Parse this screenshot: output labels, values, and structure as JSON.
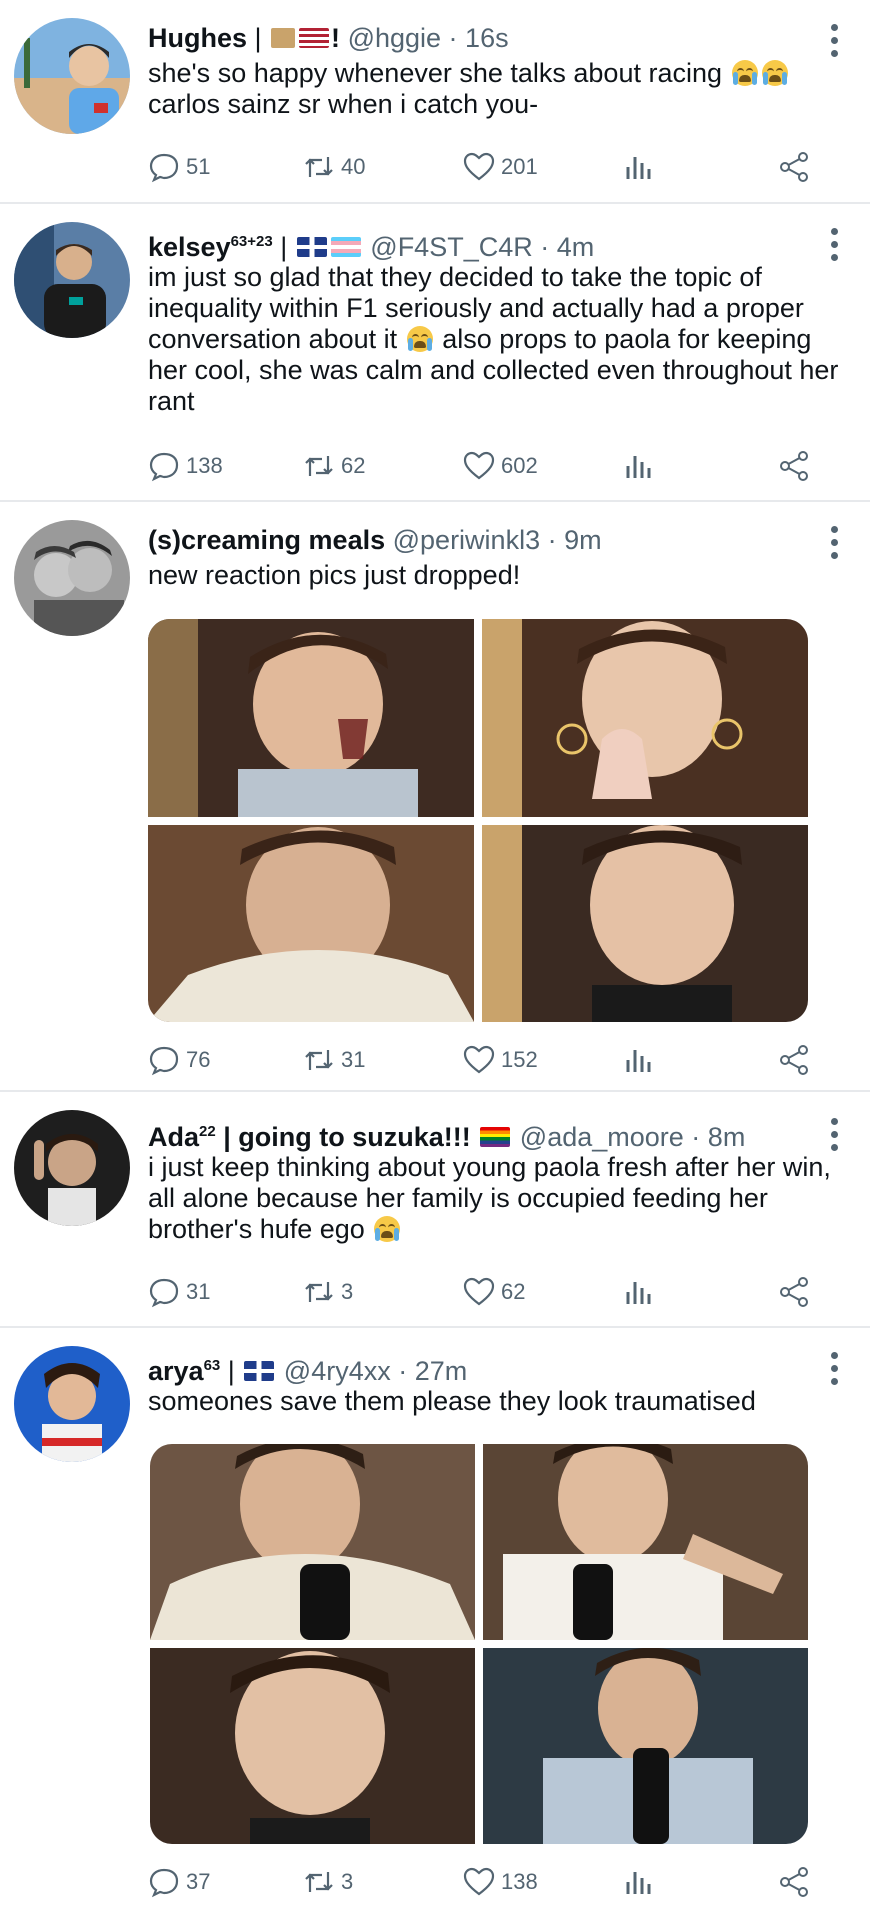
{
  "tweets": [
    {
      "name": "Hughes",
      "name_suffix": "!",
      "handle": "@hggie",
      "time": "16s",
      "text": "she's so happy whenever she talks about racing",
      "text2": "carlos sainz sr when i catch you-",
      "replies": "51",
      "retweets": "40",
      "likes": "201"
    },
    {
      "name": "kelsey",
      "name_sup": "63+23",
      "handle": "@F4ST_C4R",
      "time": "4m",
      "text": "im just so glad that they decided to take the topic of inequality within F1 seriously and actually had a proper conversation about it",
      "text_after": "also props to paola for keeping her cool, she was calm and collected even throughout her rant",
      "replies": "138",
      "retweets": "62",
      "likes": "602"
    },
    {
      "name": "(s)creaming meals",
      "handle": "@periwinkl3",
      "time": "9m",
      "text": "new reaction pics just dropped!",
      "replies": "76",
      "retweets": "31",
      "likes": "152"
    },
    {
      "name": "Ada",
      "name_sup": "22",
      "name_rest": "| going to suzuka!!!",
      "handle": "@ada_moore",
      "time": "8m",
      "text": "i just keep thinking about young paola fresh after her win, all alone because her family is occupied feeding her brother's hufe ego",
      "replies": "31",
      "retweets": "3",
      "likes": "62"
    },
    {
      "name": "arya",
      "name_sup": "63",
      "handle": "@4ry4xx",
      "time": "27m",
      "text": "someones save them please they look traumatised",
      "replies": "37",
      "retweets": "3",
      "likes": "138"
    }
  ],
  "icons": {
    "reply": "reply-icon",
    "retweet": "retweet-icon",
    "like": "heart-icon",
    "views": "views-icon",
    "share": "share-icon",
    "more": "more-icon"
  },
  "colors": {
    "text": "#0f1419",
    "secondary": "#536471",
    "divider": "#e7e9ec"
  }
}
